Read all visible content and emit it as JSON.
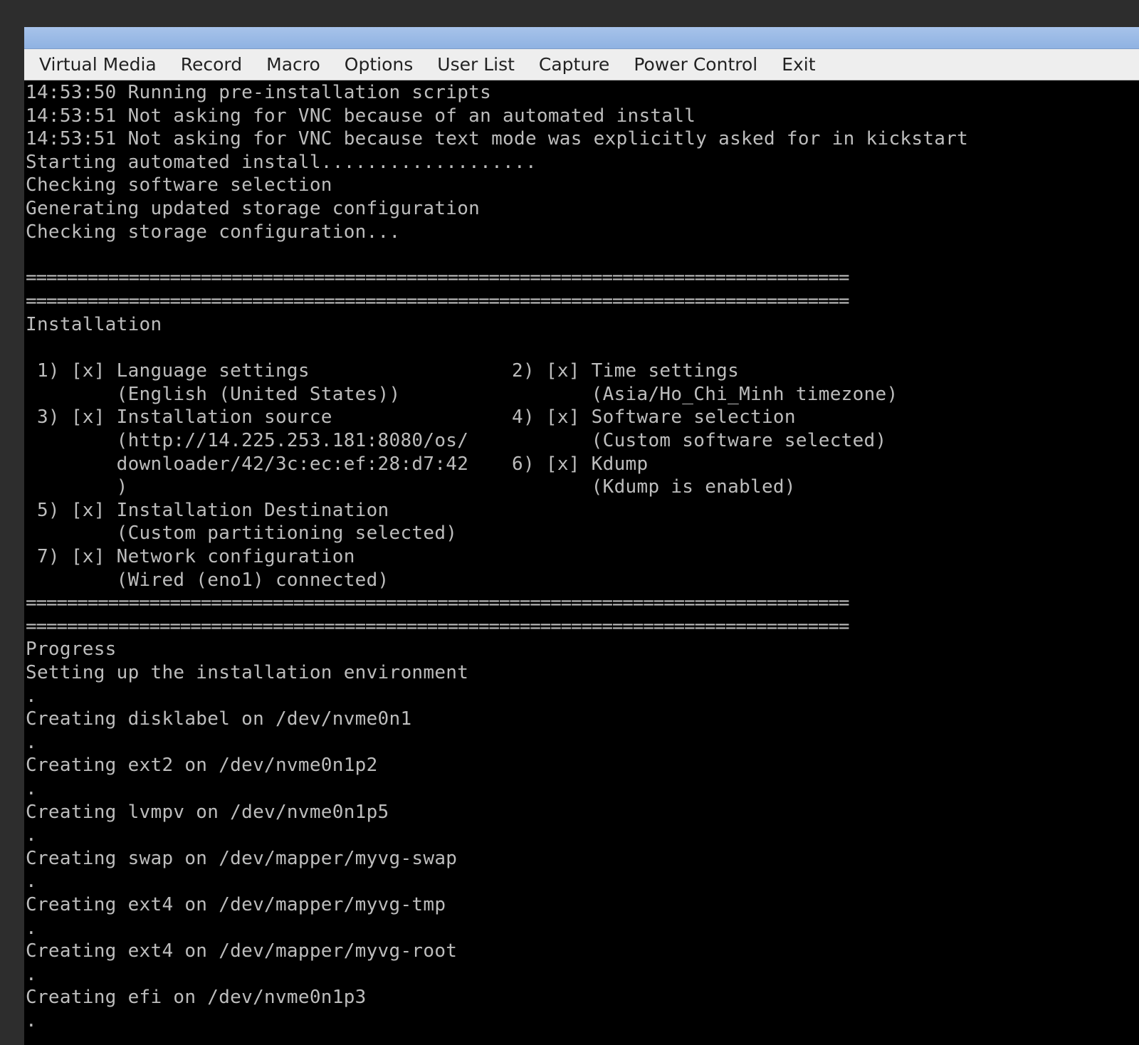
{
  "menu": {
    "items": [
      "Virtual Media",
      "Record",
      "Macro",
      "Options",
      "User List",
      "Capture",
      "Power Control",
      "Exit"
    ]
  },
  "terminal": {
    "log_lines": [
      "14:53:50 Running pre-installation scripts",
      "14:53:51 Not asking for VNC because of an automated install",
      "14:53:51 Not asking for VNC because text mode was explicitly asked for in kickstart",
      "Starting automated install...................",
      "Checking software selection",
      "Generating updated storage configuration",
      "Checking storage configuration..."
    ],
    "separator": "================================================================================",
    "section_installation": "Installation",
    "spokes_left": [
      " 1) [x] Language settings",
      "        (English (United States))",
      " 3) [x] Installation source",
      "        (http://14.225.253.181:8080/os/",
      "        downloader/42/3c:ec:ef:28:d7:42",
      "        )",
      " 5) [x] Installation Destination",
      "        (Custom partitioning selected)",
      " 7) [x] Network configuration",
      "        (Wired (eno1) connected)"
    ],
    "spokes_right": [
      "2) [x] Time settings",
      "       (Asia/Ho_Chi_Minh timezone)",
      "4) [x] Software selection",
      "       (Custom software selected)",
      "6) [x] Kdump",
      "       (Kdump is enabled)"
    ],
    "section_progress": "Progress",
    "progress_lines": [
      "Setting up the installation environment",
      ".",
      "Creating disklabel on /dev/nvme0n1",
      ".",
      "Creating ext2 on /dev/nvme0n1p2",
      ".",
      "Creating lvmpv on /dev/nvme0n1p5",
      ".",
      "Creating swap on /dev/mapper/myvg-swap",
      ".",
      "Creating ext4 on /dev/mapper/myvg-tmp",
      ".",
      "Creating ext4 on /dev/mapper/myvg-root",
      ".",
      "Creating efi on /dev/nvme0n1p3",
      "."
    ]
  }
}
